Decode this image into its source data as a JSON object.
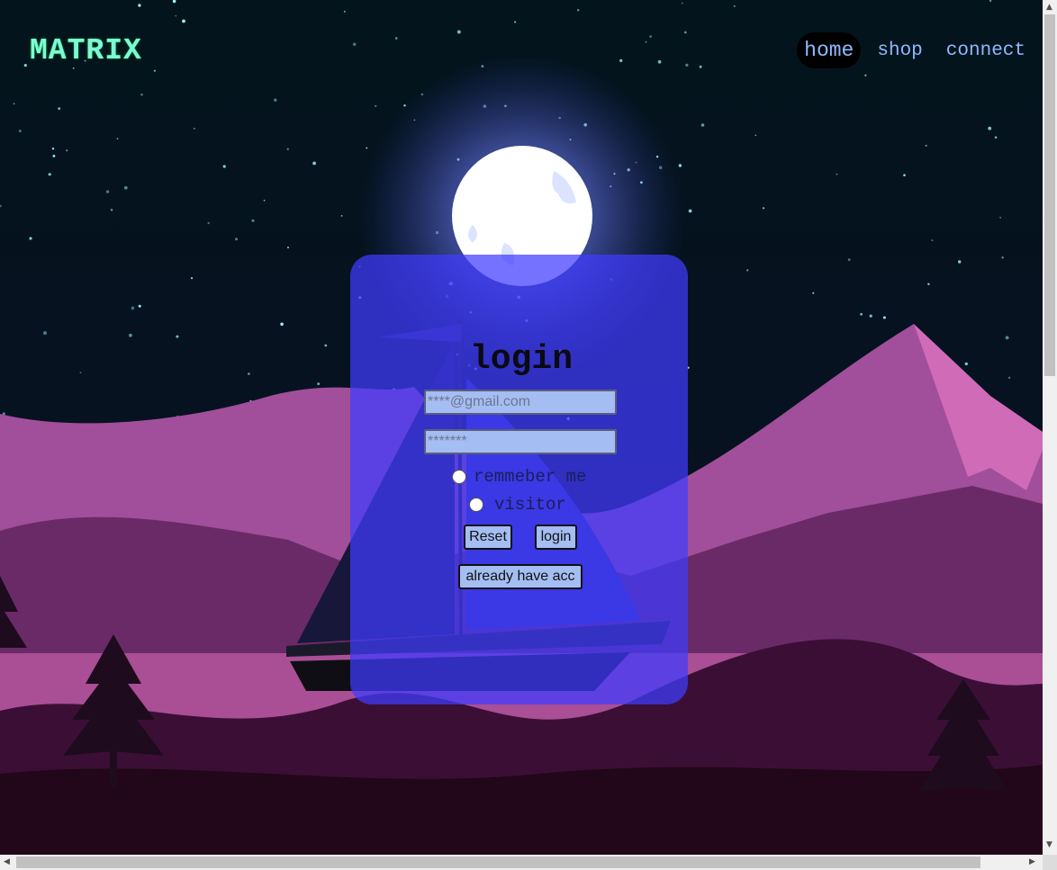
{
  "brand": {
    "logo": "MATRIX"
  },
  "nav": {
    "items": [
      "home",
      "shop",
      "connect"
    ],
    "active": "home"
  },
  "login": {
    "title": "login",
    "email_placeholder": "****@gmail.com",
    "password_placeholder": "*******",
    "remember_label": "remmeber me",
    "visitor_label": "visitor",
    "reset_label": "Reset",
    "login_label": "login",
    "already_label": "already have acc"
  },
  "colors": {
    "card": "#403cff",
    "input_bg": "#a4bdf2",
    "logo": "#7ef9d7",
    "logo_shadow": "#ff1a1a",
    "nav_text": "#8fb8ff"
  },
  "icons": {
    "scroll_up": "triangle-up",
    "scroll_down": "triangle-down",
    "scroll_left": "triangle-left",
    "scroll_right": "triangle-right"
  }
}
